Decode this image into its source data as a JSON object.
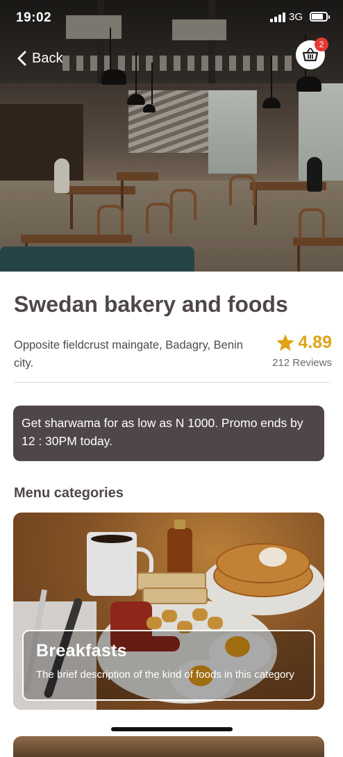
{
  "status_bar": {
    "time": "19:02",
    "network": "3G"
  },
  "header": {
    "back_label": "Back",
    "cart_count": "2"
  },
  "restaurant": {
    "name": "Swedan bakery and foods",
    "address": "Opposite fieldcrust maingate, Badagry, Benin city.",
    "rating": "4.89",
    "reviews": "212 Reviews"
  },
  "promo": {
    "text": "Get sharwama for as low as N 1000. Promo ends by 12 : 30PM today."
  },
  "menu": {
    "section_title": "Menu categories",
    "categories": [
      {
        "name": "Breakfasts",
        "description": "The brief description of the kind of foods in this category"
      }
    ]
  },
  "colors": {
    "dark": "#4f4747",
    "star": "#e0a316",
    "badge": "#e53935"
  },
  "icons": {
    "back": "chevron-left-icon",
    "cart": "basket-icon",
    "rating": "star-icon"
  }
}
